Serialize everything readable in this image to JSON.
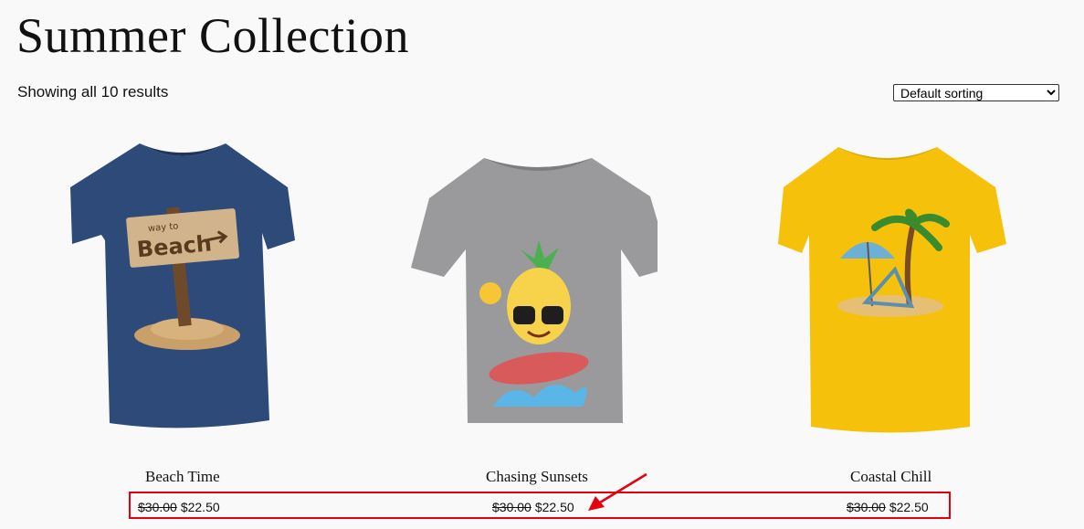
{
  "page": {
    "title": "Summer Collection",
    "results_count": "Showing all 10 results"
  },
  "sorting": {
    "selected": "Default sorting"
  },
  "products": [
    {
      "name": "Beach Time",
      "regular_price": "$30.00",
      "sale_price": "$22.50",
      "shirt_color": "#2e4a78",
      "sign_text_small": "way to",
      "sign_text": "Beach"
    },
    {
      "name": "Chasing Sunsets",
      "regular_price": "$30.00",
      "sale_price": "$22.50",
      "shirt_color": "#9a9a9c"
    },
    {
      "name": "Coastal Chill",
      "regular_price": "$30.00",
      "sale_price": "$22.50",
      "shirt_color": "#f5c10a"
    }
  ],
  "annotation": {
    "color": "#e3000f"
  }
}
